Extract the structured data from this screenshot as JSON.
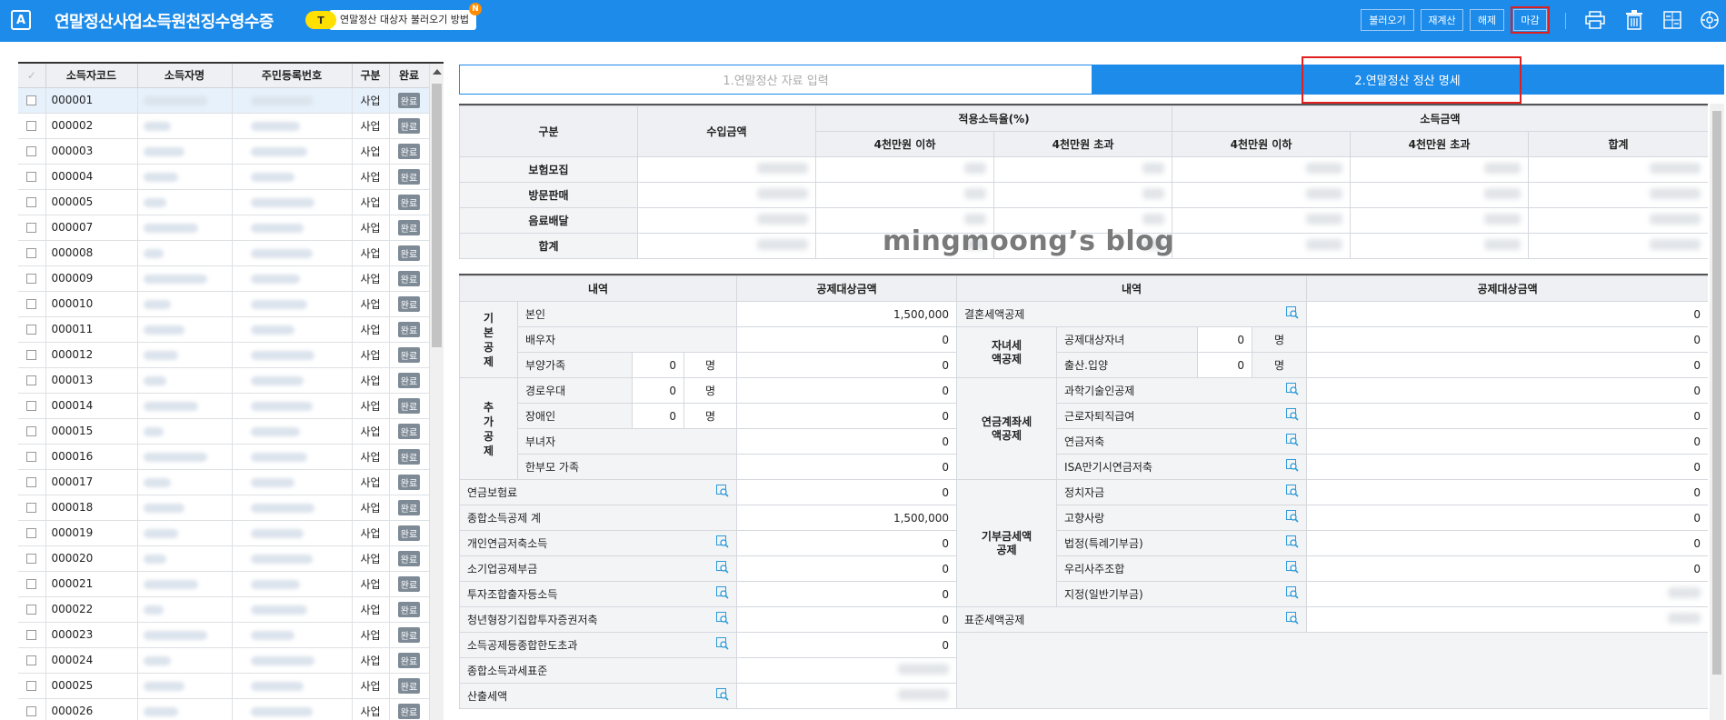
{
  "app": {
    "logo": "A",
    "title": "연말정산사업소득원천징수영수증"
  },
  "help": {
    "badge": "T",
    "text": "연말정산 대상자 불러오기 방법",
    "new_badge": "N"
  },
  "toolbar": {
    "load": "불러오기",
    "recalc": "재계산",
    "release": "해제",
    "close": "마감",
    "icons": [
      "print-icon",
      "trash-icon",
      "calculator-icon",
      "settings-icon"
    ]
  },
  "left_grid": {
    "columns": [
      "소득자코드",
      "소득자명",
      "주민등록번호",
      "구분",
      "완료"
    ],
    "rows": [
      {
        "code": "000001",
        "type": "사업",
        "done": "완료"
      },
      {
        "code": "000002",
        "type": "사업",
        "done": "완료"
      },
      {
        "code": "000003",
        "type": "사업",
        "done": "완료"
      },
      {
        "code": "000004",
        "type": "사업",
        "done": "완료"
      },
      {
        "code": "000005",
        "type": "사업",
        "done": "완료"
      },
      {
        "code": "000007",
        "type": "사업",
        "done": "완료"
      },
      {
        "code": "000008",
        "type": "사업",
        "done": "완료"
      },
      {
        "code": "000009",
        "type": "사업",
        "done": "완료"
      },
      {
        "code": "000010",
        "type": "사업",
        "done": "완료"
      },
      {
        "code": "000011",
        "type": "사업",
        "done": "완료"
      },
      {
        "code": "000012",
        "type": "사업",
        "done": "완료"
      },
      {
        "code": "000013",
        "type": "사업",
        "done": "완료"
      },
      {
        "code": "000014",
        "type": "사업",
        "done": "완료"
      },
      {
        "code": "000015",
        "type": "사업",
        "done": "완료"
      },
      {
        "code": "000016",
        "type": "사업",
        "done": "완료"
      },
      {
        "code": "000017",
        "type": "사업",
        "done": "완료"
      },
      {
        "code": "000018",
        "type": "사업",
        "done": "완료"
      },
      {
        "code": "000019",
        "type": "사업",
        "done": "완료"
      },
      {
        "code": "000020",
        "type": "사업",
        "done": "완료"
      },
      {
        "code": "000021",
        "type": "사업",
        "done": "완료"
      },
      {
        "code": "000022",
        "type": "사업",
        "done": "완료"
      },
      {
        "code": "000023",
        "type": "사업",
        "done": "완료"
      },
      {
        "code": "000024",
        "type": "사업",
        "done": "완료"
      },
      {
        "code": "000025",
        "type": "사업",
        "done": "완료"
      },
      {
        "code": "000026",
        "type": "사업",
        "done": "완료"
      }
    ]
  },
  "tabs": [
    "1.연말정산 자료 입력",
    "2.연말정산 정산 명세"
  ],
  "income_table": {
    "h_category": "구분",
    "h_revenue": "수입금액",
    "h_rate": "적용소득율(%)",
    "h_income": "소득금액",
    "h_under": "4천만원 이하",
    "h_over": "4천만원 초과",
    "h_total": "합계",
    "rows": [
      "보험모집",
      "방문판매",
      "음료배달",
      "합계"
    ]
  },
  "watermark": "mingmoong’s blog",
  "deduction": {
    "h_item": "내역",
    "h_amount": "공제대상금액",
    "basic_group": "기본공제",
    "self": "본인",
    "self_amount": "1,500,000",
    "spouse": "배우자",
    "spouse_amount": "0",
    "dependents": "부양가족",
    "dependents_count": "0",
    "dependents_amount": "0",
    "extra_group": "추가공제",
    "elderly": "경로우대",
    "elderly_count": "0",
    "elderly_amount": "0",
    "disabled": "장애인",
    "disabled_count": "0",
    "disabled_amount": "0",
    "woman": "부녀자",
    "woman_amount": "0",
    "single_parent": "한부모 가족",
    "single_parent_amount": "0",
    "unit": "명",
    "pension_ins": "연금보험료",
    "pension_ins_amount": "0",
    "total_income_ded": "종합소득공제 계",
    "total_income_ded_amount": "1,500,000",
    "personal_pension": "개인연금저축소득",
    "personal_pension_amount": "0",
    "small_biz": "소기업공제부금",
    "small_biz_amount": "0",
    "invest": "투자조합출자등소득",
    "invest_amount": "0",
    "youth": "청년형장기집합투자증권저축",
    "youth_amount": "0",
    "limit": "소득공제등종합한도초과",
    "limit_amount": "0",
    "tax_base": "종합소득과세표준",
    "calc_tax": "산출세액"
  },
  "tax_credit": {
    "marriage": "결혼세액공제",
    "marriage_amount": "0",
    "child_group": "자녀세액공제",
    "child": "공제대상자녀",
    "child_count": "0",
    "child_amount": "0",
    "birth": "출산.입양",
    "birth_count": "0",
    "birth_amount": "0",
    "pension_group": "연금계좌세액공제",
    "science": "과학기술인공제",
    "science_amount": "0",
    "retire": "근로자퇴직급여",
    "retire_amount": "0",
    "pension_saving": "연금저축",
    "pension_saving_amount": "0",
    "isa": "ISA만기시연금저축",
    "isa_amount": "0",
    "donation_group": "기부금세액공제",
    "political": "정치자금",
    "political_amount": "0",
    "hometown": "고향사랑",
    "hometown_amount": "0",
    "legal": "법정(특례기부금)",
    "legal_amount": "0",
    "esop": "우리사주조합",
    "esop_amount": "0",
    "designated": "지정(일반기부금)",
    "standard": "표준세액공제",
    "unit": "명"
  }
}
